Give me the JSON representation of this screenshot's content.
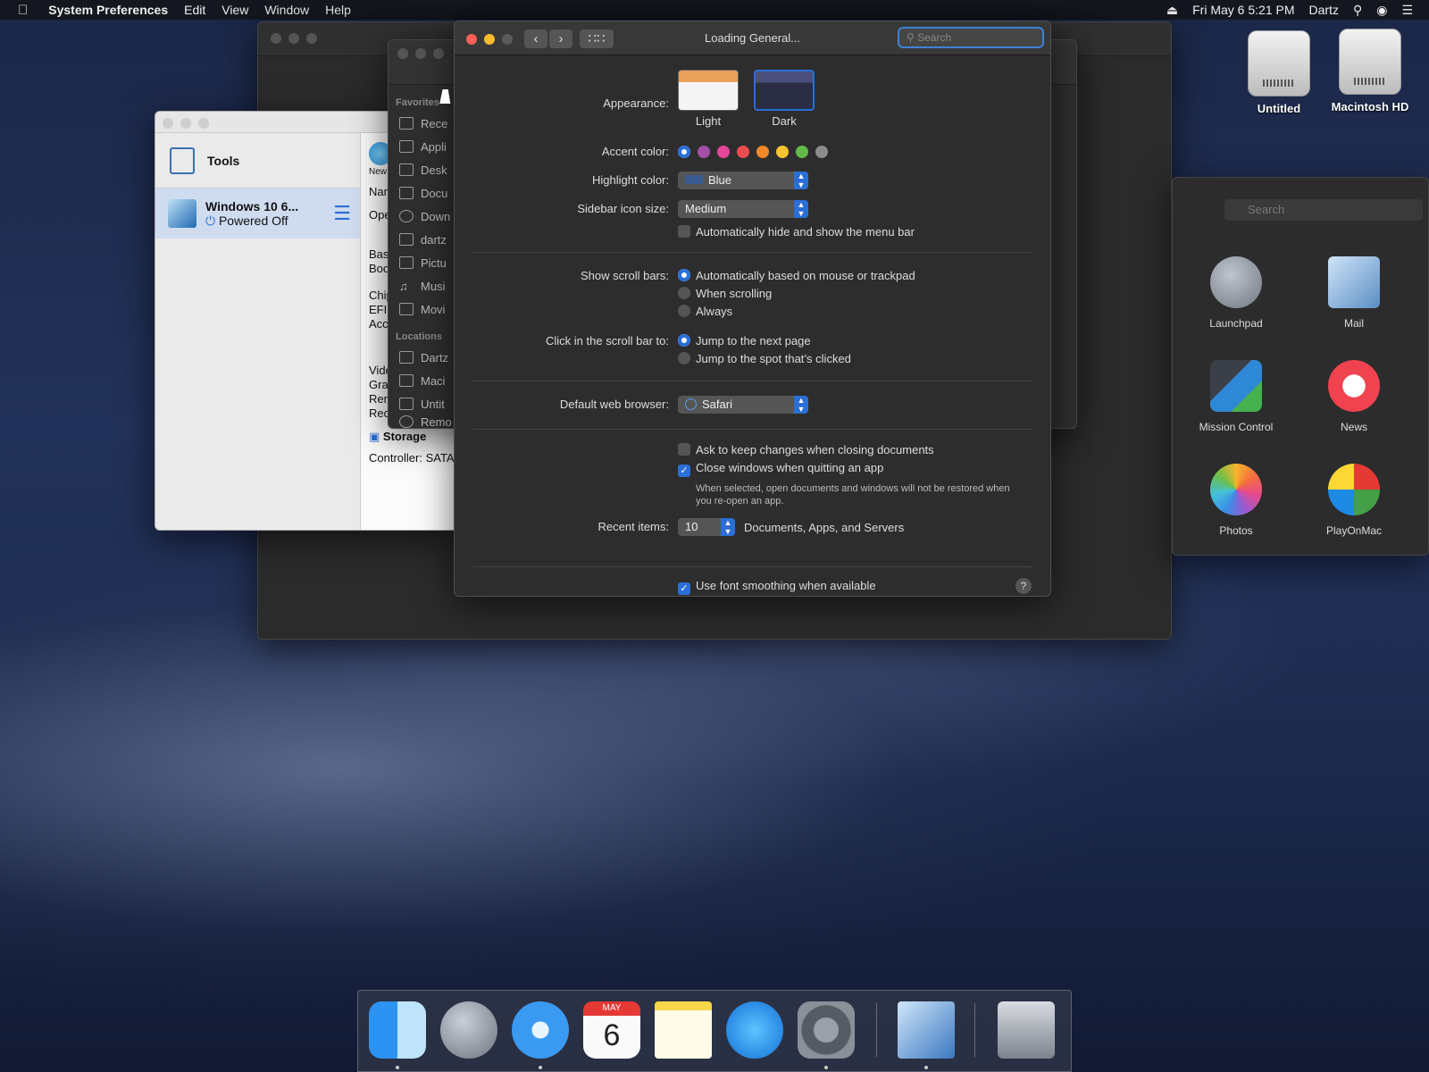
{
  "menubar": {
    "app_name": "System Preferences",
    "items": [
      "Edit",
      "View",
      "Window",
      "Help"
    ],
    "clock": "Fri May 6  5:21 PM",
    "user": "Dartz"
  },
  "desktop": {
    "drives": [
      {
        "label": "Untitled"
      },
      {
        "label": "Macintosh HD"
      }
    ]
  },
  "vbox": {
    "tools_label": "Tools",
    "vm_name": "Windows 10 6...",
    "vm_status": "Powered Off",
    "new_label": "New",
    "details": [
      "Nam",
      "Ope",
      "Base",
      "Boo",
      "Chip",
      "EFI:",
      "Acc",
      "Video Memory:",
      "Graphics Contro",
      "Remote Desktop",
      "Recording:"
    ],
    "storage_label": "Storage",
    "controller": "Controller: SATA"
  },
  "finder": {
    "favorites_header": "Favorites",
    "favorites": [
      "Rece",
      "Appli",
      "Desk",
      "Docu",
      "Down",
      "dartz",
      "Pictu",
      "Musi",
      "Movi"
    ],
    "locations_header": "Locations",
    "locations": [
      "Dartz",
      "Maci",
      "Untit",
      "Remo"
    ]
  },
  "apps_window": {
    "search_placeholder": "Search",
    "apps": [
      {
        "label": "Launchpad"
      },
      {
        "label": "Mail"
      },
      {
        "label": "Mission Control"
      },
      {
        "label": "News"
      },
      {
        "label": "Photos"
      },
      {
        "label": "PlayOnMac"
      }
    ]
  },
  "prefs": {
    "title": "Loading General...",
    "search_placeholder": "Search",
    "appearance_label": "Appearance:",
    "appearance_options": [
      "Light",
      "Dark"
    ],
    "accent_label": "Accent color:",
    "accent_colors": [
      "#2a6fd6",
      "#a550a7",
      "#e4479a",
      "#ec4c51",
      "#f38928",
      "#f5c431",
      "#62ba46",
      "#8c8c8c"
    ],
    "highlight_label": "Highlight color:",
    "highlight_value": "Blue",
    "sidebar_label": "Sidebar icon size:",
    "sidebar_value": "Medium",
    "auto_hide_menu": "Automatically hide and show the menu bar",
    "scroll_bars_label": "Show scroll bars:",
    "scroll_bar_options": [
      "Automatically based on mouse or trackpad",
      "When scrolling",
      "Always"
    ],
    "click_scroll_label": "Click in the scroll bar to:",
    "click_scroll_options": [
      "Jump to the next page",
      "Jump to the spot that’s clicked"
    ],
    "browser_label": "Default web browser:",
    "browser_value": "Safari",
    "ask_keep_changes": "Ask to keep changes when closing documents",
    "close_windows": "Close windows when quitting an app",
    "close_windows_note": "When selected, open documents and windows will not be restored when you re-open an app.",
    "recent_label": "Recent items:",
    "recent_value": "10",
    "recent_suffix": "Documents, Apps, and Servers",
    "font_smoothing": "Use font smoothing when available",
    "help": "?"
  },
  "dock": {
    "calendar_month": "MAY",
    "calendar_day": "6"
  }
}
